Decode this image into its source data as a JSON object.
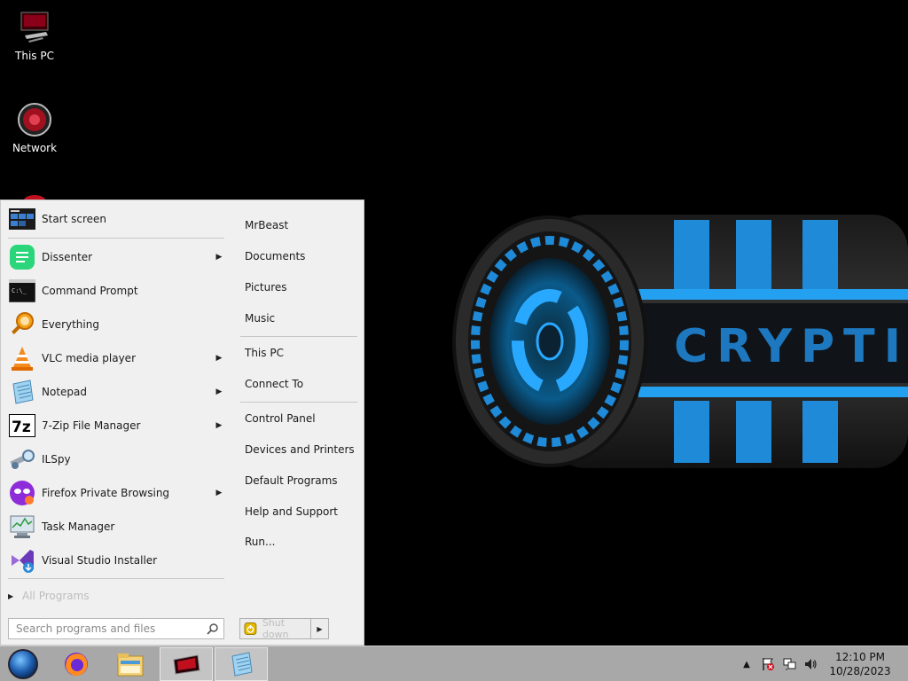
{
  "desktop": {
    "icons": [
      {
        "label": "This PC",
        "icon": "this-pc-icon"
      },
      {
        "label": "Network",
        "icon": "network-icon"
      }
    ],
    "wallpaper_text": "CRYPTIC"
  },
  "start_menu": {
    "start_screen_label": "Start screen",
    "programs": [
      {
        "label": "Dissenter",
        "icon": "dissenter-icon",
        "submenu": true
      },
      {
        "label": "Command Prompt",
        "icon": "command-prompt-icon",
        "submenu": false
      },
      {
        "label": "Everything",
        "icon": "everything-search-icon",
        "submenu": false
      },
      {
        "label": "VLC media player",
        "icon": "vlc-cone-icon",
        "submenu": true
      },
      {
        "label": "Notepad",
        "icon": "notepad-icon",
        "submenu": true
      },
      {
        "label": "7-Zip File Manager",
        "icon": "seven-zip-icon",
        "submenu": true
      },
      {
        "label": "ILSpy",
        "icon": "ilspy-icon",
        "submenu": false
      },
      {
        "label": "Firefox Private Browsing",
        "icon": "firefox-private-icon",
        "submenu": true
      },
      {
        "label": "Task Manager",
        "icon": "task-manager-icon",
        "submenu": false
      },
      {
        "label": "Visual Studio Installer",
        "icon": "visual-studio-installer-icon",
        "submenu": false
      }
    ],
    "all_programs_label": "All Programs",
    "search_placeholder": "Search programs and files",
    "places_group1": [
      "MrBeast",
      "Documents",
      "Pictures",
      "Music"
    ],
    "places_group2": [
      "This PC",
      "Connect To"
    ],
    "places_group3": [
      "Control Panel",
      "Devices and Printers",
      "Default Programs",
      "Help and Support",
      "Run..."
    ],
    "shutdown_label": "Shut down"
  },
  "taskbar": {
    "pinned": [
      {
        "name": "firefox",
        "icon": "firefox-icon",
        "active": false
      },
      {
        "name": "file-explorer",
        "icon": "file-explorer-icon",
        "active": false
      },
      {
        "name": "wallpaper-app",
        "icon": "red-device-icon",
        "active": true
      },
      {
        "name": "notepad",
        "icon": "notepad-icon",
        "active": true
      }
    ],
    "clock": {
      "time": "12:10 PM",
      "date": "10/28/2023"
    }
  }
}
